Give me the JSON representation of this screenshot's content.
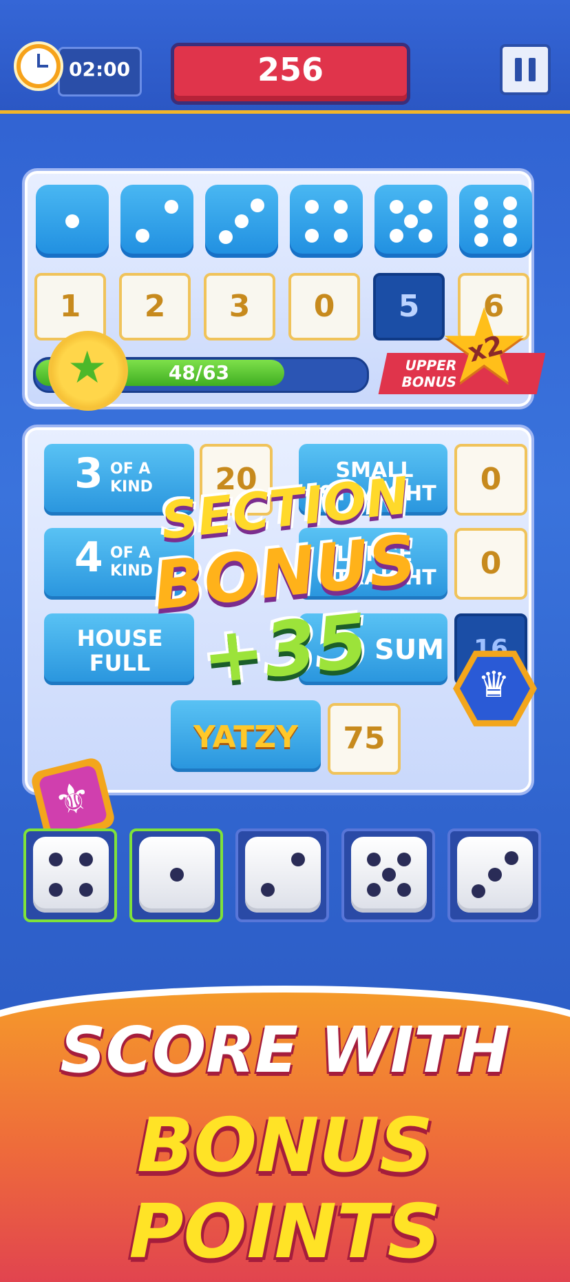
{
  "hud": {
    "timer": "02:00",
    "score": "256"
  },
  "upper_section": {
    "dice_faces": [
      1,
      2,
      3,
      4,
      5,
      6
    ],
    "scores": [
      "1",
      "2",
      "3",
      "0",
      "5",
      "6"
    ],
    "progress": {
      "text": "48/63",
      "value": 48,
      "max": 63
    },
    "bonus_label": "UPPER BONUS",
    "multiplier": "x2"
  },
  "lower_section": {
    "rows": [
      {
        "label_big": "3",
        "label_small": "OF A KIND",
        "score": "20"
      },
      {
        "label": "SMALL STRAIGHT",
        "score": "0"
      },
      {
        "label_big": "4",
        "label_small": "OF A KIND",
        "score": ""
      },
      {
        "label": "LARGE STRAIGHT",
        "score": "0"
      },
      {
        "label": "HOUSE FULL",
        "score": ""
      },
      {
        "label": "SUM",
        "score": "16"
      }
    ],
    "yatzy": {
      "label": "YATZY",
      "score": "75"
    }
  },
  "popup": {
    "line1": "SECTION",
    "line2": "BONUS",
    "line3": "+35"
  },
  "rolled_dice": [
    {
      "face": 4,
      "held": true
    },
    {
      "face": 1,
      "held": true
    },
    {
      "face": 2,
      "held": false
    },
    {
      "face": 5,
      "held": false
    },
    {
      "face": 3,
      "held": false
    }
  ],
  "banner": {
    "line1": "SCORE WITH",
    "line2": "BONUS POINTS"
  },
  "colors": {
    "accent": "#f2b52a",
    "score_red": "#e0344b",
    "panel": "#c9d8fb",
    "held_border": "#7fe23a"
  }
}
